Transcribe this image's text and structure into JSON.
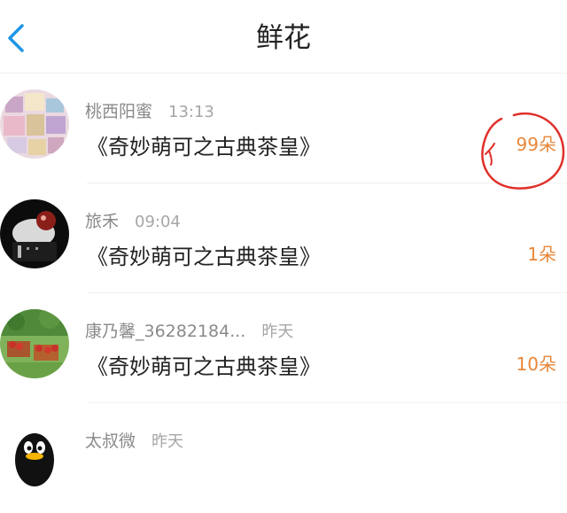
{
  "header": {
    "title": "鲜花",
    "back_icon": "chevron-left-icon"
  },
  "rows": [
    {
      "name": "桃西阳蜜",
      "time": "13:13",
      "message": "《奇妙萌可之古典茶皇》",
      "count": "99朵"
    },
    {
      "name": "旅禾",
      "time": "09:04",
      "message": "《奇妙萌可之古典茶皇》",
      "count": "1朵"
    },
    {
      "name": "康乃馨_36282184...",
      "time": "昨天",
      "message": "《奇妙萌可之古典茶皇》",
      "count": "10朵"
    },
    {
      "name": "太叔微",
      "time": "昨天",
      "message": "",
      "count": ""
    }
  ],
  "colors": {
    "accent": "#1e96e6",
    "count": "#e8873a",
    "annotation": "#e0302a"
  }
}
